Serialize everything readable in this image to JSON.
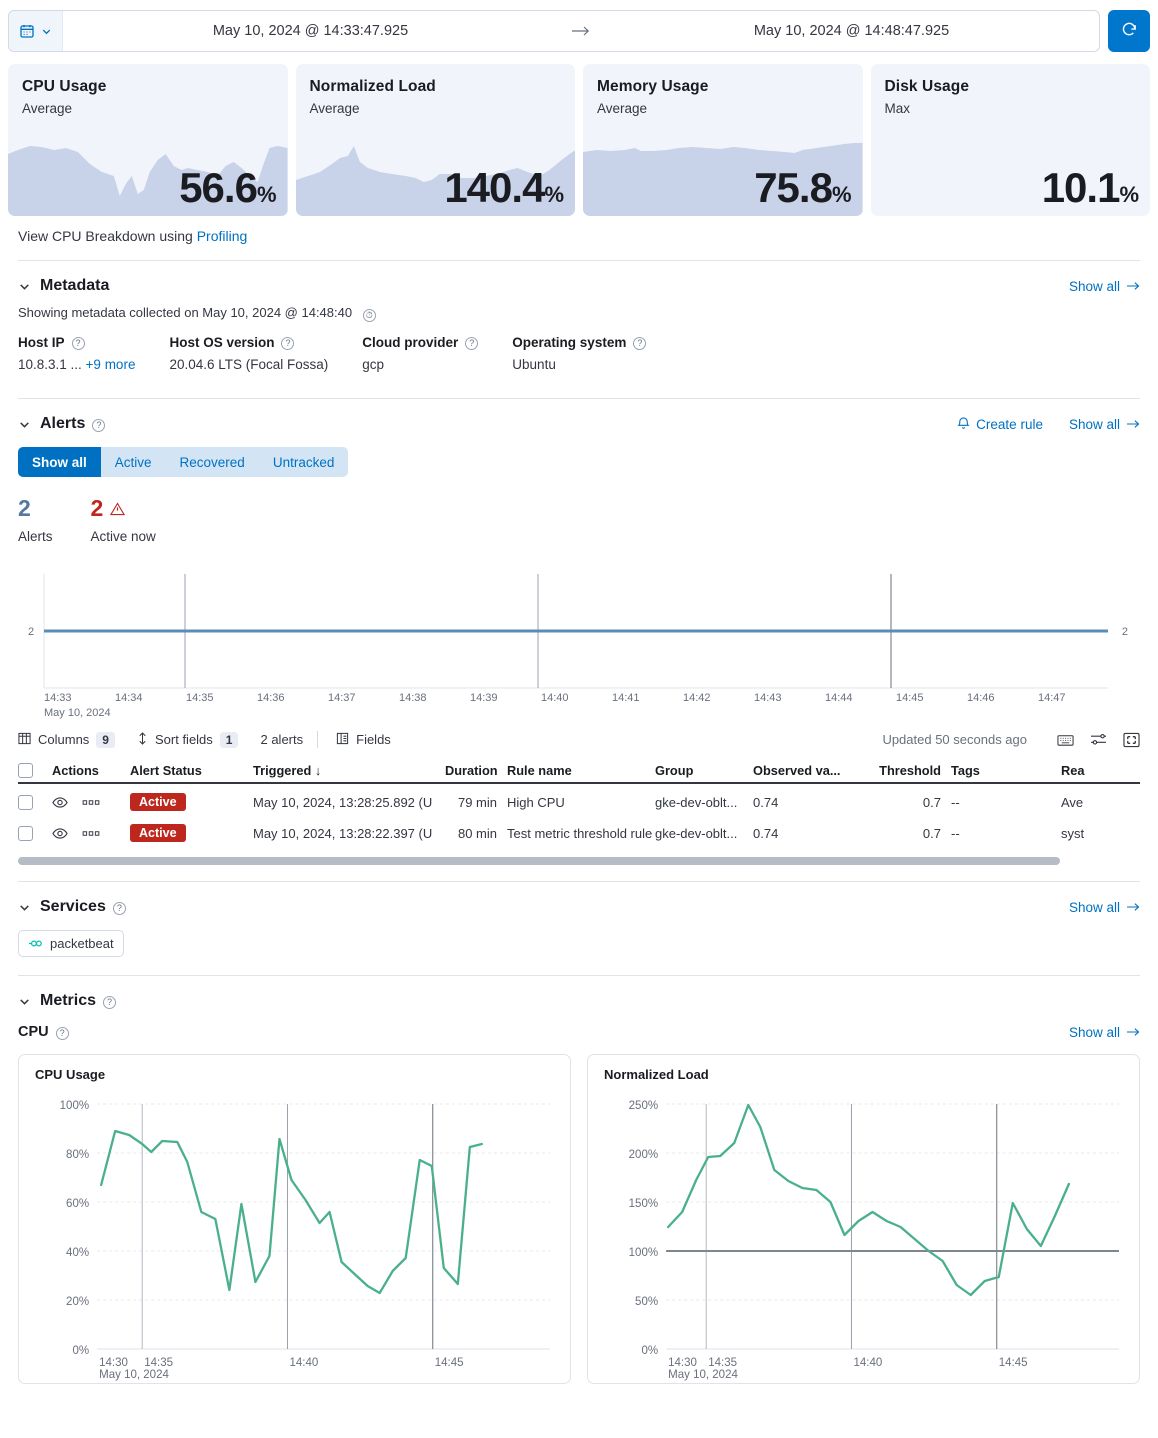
{
  "topbar": {
    "calendar_icon": "calendar-icon",
    "chevron_icon": "chevron-down-icon",
    "start_date": "May 10, 2024 @ 14:33:47.925",
    "arrow": "→",
    "end_date": "May 10, 2024 @ 14:48:47.925",
    "refresh_icon": "refresh-icon"
  },
  "kpis": [
    {
      "title": "CPU Usage",
      "subtitle": "Average",
      "value": "56.6",
      "unit": "%"
    },
    {
      "title": "Normalized Load",
      "subtitle": "Average",
      "value": "140.4",
      "unit": "%"
    },
    {
      "title": "Memory Usage",
      "subtitle": "Average",
      "value": "75.8",
      "unit": "%"
    },
    {
      "title": "Disk Usage",
      "subtitle": "Max",
      "value": "10.1",
      "unit": "%"
    }
  ],
  "profiling": {
    "prefix": "View CPU Breakdown using ",
    "link": "Profiling"
  },
  "metadata": {
    "title": "Metadata",
    "show_all": "Show all",
    "note": "Showing metadata collected on May 10, 2024 @ 14:48:40",
    "fields": [
      {
        "label": "Host IP",
        "value": "10.8.3.1 ... ",
        "extra": "+9 more"
      },
      {
        "label": "Host OS version",
        "value": "20.04.6 LTS (Focal Fossa)",
        "extra": ""
      },
      {
        "label": "Cloud provider",
        "value": "gcp",
        "extra": ""
      },
      {
        "label": "Operating system",
        "value": "Ubuntu",
        "extra": ""
      }
    ]
  },
  "alerts": {
    "title": "Alerts",
    "create_rule": "Create rule",
    "show_all": "Show all",
    "filters": [
      {
        "label": "Show all",
        "active": true
      },
      {
        "label": "Active",
        "active": false
      },
      {
        "label": "Recovered",
        "active": false
      },
      {
        "label": "Untracked",
        "active": false
      }
    ],
    "counts": [
      {
        "num": "2",
        "label": "Alerts",
        "tone": "blue"
      },
      {
        "num": "2",
        "label": "Active now",
        "tone": "red"
      }
    ],
    "chart": {
      "y_label_left": "2",
      "y_label_right": "2",
      "date_label": "May 10, 2024",
      "ticks": [
        "14:33",
        "14:34",
        "14:35",
        "14:36",
        "14:37",
        "14:38",
        "14:39",
        "14:40",
        "14:41",
        "14:42",
        "14:43",
        "14:44",
        "14:45",
        "14:46",
        "14:47"
      ]
    },
    "toolbar": {
      "columns_label": "Columns",
      "columns_count": "9",
      "sort_label": "Sort fields",
      "sort_count": "1",
      "alerts_count_label": "2 alerts",
      "fields_label": "Fields",
      "updated": "Updated 50 seconds ago",
      "keyboard_icon": "keyboard-icon",
      "display_icon": "display-options-icon",
      "fullscreen_icon": "fullscreen-icon"
    },
    "table": {
      "headers": [
        "Actions",
        "Alert Status",
        "Triggered",
        "Duration",
        "Rule name",
        "Group",
        "Observed va...",
        "Threshold",
        "Tags",
        "Rea"
      ],
      "sort_arrow": "↓",
      "rows": [
        {
          "status": "Active",
          "triggered": "May 10, 2024, 13:28:25.892 (U",
          "duration": "79 min",
          "rule_name": "High CPU",
          "group": "gke-dev-oblt...",
          "observed": "0.74",
          "threshold": "0.7",
          "tags": "--",
          "reason": "Ave"
        },
        {
          "status": "Active",
          "triggered": "May 10, 2024, 13:28:22.397 (U",
          "duration": "80 min",
          "rule_name": "Test metric threshold rule",
          "group": "gke-dev-oblt...",
          "observed": "0.74",
          "threshold": "0.7",
          "tags": "--",
          "reason": "syst"
        }
      ]
    }
  },
  "services": {
    "title": "Services",
    "show_all": "Show all",
    "items": [
      {
        "label": "packetbeat",
        "icon": "link-icon"
      }
    ]
  },
  "metrics": {
    "title": "Metrics",
    "cpu_title": "CPU",
    "cpu_show_all": "Show all"
  },
  "chart_data": [
    {
      "type": "line",
      "title": "CPU Usage",
      "xlabel": "",
      "ylabel": "",
      "date_label": "May 10, 2024",
      "xtick_labels": [
        "14:30",
        "14:35",
        "14:40",
        "14:45"
      ],
      "ytick_labels": [
        "0%",
        "20%",
        "40%",
        "60%",
        "80%",
        "100%"
      ],
      "ylim": [
        0,
        100
      ],
      "grid": true,
      "line_color": "#4ab08c",
      "x": [
        "14:29",
        "14:30",
        "14:30:30",
        "14:31",
        "14:32",
        "14:33",
        "14:33:30",
        "14:34",
        "14:34:30",
        "14:35",
        "14:35:30",
        "14:36",
        "14:36:30",
        "14:37",
        "14:37:30",
        "14:38",
        "14:38:30",
        "14:39",
        "14:39:30",
        "14:40",
        "14:40:30",
        "14:41",
        "14:41:30",
        "14:42",
        "14:42:30",
        "14:43",
        "14:43:30",
        "14:44",
        "14:44:30",
        "14:45",
        "14:45:30",
        "14:46",
        "14:46:30",
        "14:47",
        "14:47:30",
        "14:48"
      ],
      "values": [
        67,
        89,
        87,
        82,
        79,
        85,
        84,
        76,
        56,
        54,
        24,
        59,
        27,
        38,
        87,
        69,
        61,
        51,
        56,
        35,
        30,
        26,
        23,
        32,
        37,
        68,
        66,
        33,
        27,
        82,
        83
      ]
    },
    {
      "type": "line",
      "title": "Normalized Load",
      "xlabel": "",
      "ylabel": "",
      "date_label": "May 10, 2024",
      "xtick_labels": [
        "14:30",
        "14:35",
        "14:40",
        "14:45"
      ],
      "ytick_labels": [
        "0%",
        "50%",
        "100%",
        "150%",
        "200%",
        "250%"
      ],
      "ylim": [
        0,
        250
      ],
      "grid": true,
      "threshold_line": 100,
      "line_color": "#4ab08c",
      "x": [
        "14:29",
        "14:30",
        "14:31",
        "14:32",
        "14:33",
        "14:34",
        "14:35",
        "14:36",
        "14:37",
        "14:38",
        "14:39",
        "14:40",
        "14:41",
        "14:42",
        "14:43",
        "14:44",
        "14:45",
        "14:46",
        "14:47",
        "14:48"
      ],
      "values": [
        125,
        140,
        168,
        195,
        196,
        210,
        248,
        228,
        183,
        172,
        164,
        162,
        150,
        117,
        131,
        142,
        131,
        123,
        112,
        99,
        90,
        74,
        63,
        70,
        73,
        148,
        123,
        106,
        134,
        167
      ]
    }
  ]
}
